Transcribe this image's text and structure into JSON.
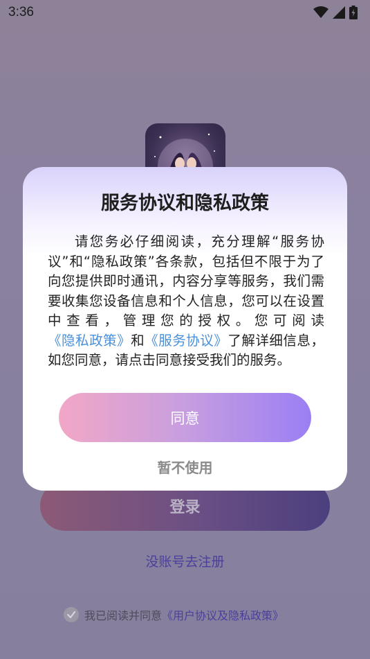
{
  "status_bar": {
    "time": "3:36",
    "icons": [
      "wifi-icon",
      "signal-icon",
      "battery-icon"
    ]
  },
  "background": {
    "login_label": "登录",
    "register_label": "没账号去注册",
    "agreement_prefix": "我已阅读并同意",
    "agreement_link": "《用户协议及隐私政策》"
  },
  "dialog": {
    "title": "服务协议和隐私政策",
    "body_part1": "请您务必仔细阅读，充分理解“服务协议”和“隐私政策”各条款，包括但不限于为了向您提供即时通讯，内容分享等服务，我们需要收集您设备信息和个人信息，您可以在设置中查看，管理您的授权。您可阅读",
    "privacy_link": "《隐私政策》",
    "body_and": "和",
    "service_link": "《服务协议》",
    "body_part2": "了解详细信息，如您同意，请点击同意接受我们的服务。",
    "agree_label": "同意",
    "decline_label": "暂不使用"
  },
  "colors": {
    "accent_link": "#4a90d9",
    "agree_gradient_start": "#f2a7c6",
    "agree_gradient_end": "#9b7ff3"
  }
}
